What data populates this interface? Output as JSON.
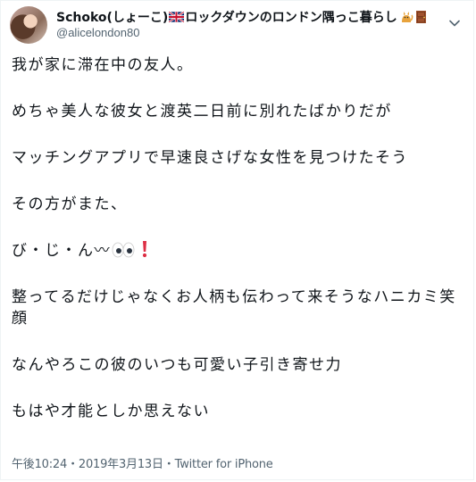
{
  "tweet": {
    "author": {
      "display_name_prefix": "Schoko(しょーこ)",
      "display_name_suffix": "ロックダウンのロンドン隅っこ暮らし",
      "handle": "@alicelondon80",
      "name_icons": [
        "uk-flag-icon",
        "cat-icon",
        "door-icon"
      ]
    },
    "body": {
      "line1": "我が家に滞在中の友人。",
      "line2": "めちゃ美人な彼女と渡英二日前に別れたばかりだが",
      "line3": "マッチングアプリで早速良さげな女性を見つけたそう",
      "line4": "その方がまた、",
      "line5": "び・じ・ん〰",
      "line6a": "整ってるだけじゃなくお人柄も伝わって来そうなハニカミ笑",
      "line6b": "顔",
      "line7": "なんやろこの彼のいつも可愛い子引き寄せ力",
      "line8": "もはや才能としか思えない"
    },
    "meta": {
      "time": "午後10:24",
      "separator": "・",
      "date": "2019年3月13日",
      "separator2": "・",
      "source": "Twitter for iPhone"
    },
    "colors": {
      "text": "#0f1419",
      "secondary": "#536471"
    }
  }
}
